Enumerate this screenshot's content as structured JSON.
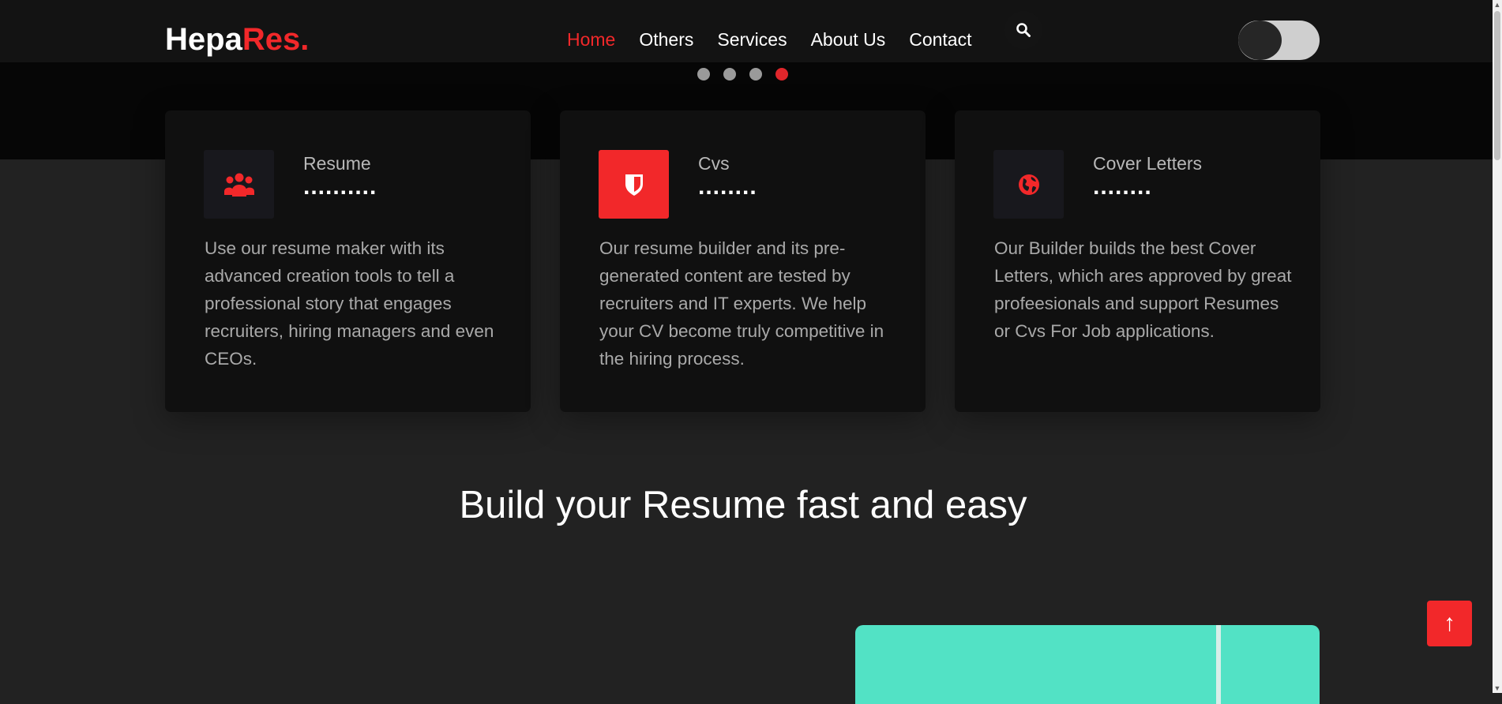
{
  "brand": {
    "part1": "Hepa",
    "part2": "Res."
  },
  "nav": {
    "items": [
      {
        "label": "Home",
        "active": true
      },
      {
        "label": "Others",
        "active": false
      },
      {
        "label": "Services",
        "active": false
      },
      {
        "label": "About Us",
        "active": false
      },
      {
        "label": "Contact",
        "active": false
      }
    ],
    "search_icon": "search-icon",
    "theme_toggle": "dark-mode-toggle"
  },
  "carousel": {
    "dot_count": 4,
    "active_index": 3
  },
  "cards": [
    {
      "icon": "users-icon",
      "title": "Resume",
      "dots": "..........",
      "description": "Use our resume maker with its advanced creation tools to tell a professional story that engages recruiters, hiring managers and even CEOs."
    },
    {
      "icon": "shield-icon",
      "title": "Cvs",
      "dots": "........",
      "description": "Our resume builder and its pre-generated content are tested by recruiters and IT experts. We help your CV become truly competitive in the hiring process."
    },
    {
      "icon": "globe-icon",
      "title": "Cover Letters",
      "dots": "........",
      "description": "Our Builder builds the best Cover Letters, which ares approved by great profeesionals and support Resumes or Cvs For Job applications."
    }
  ],
  "section": {
    "title": "Build your Resume fast and easy"
  },
  "back_to_top": {
    "label": "↑"
  },
  "colors": {
    "accent": "#f2282a",
    "teal": "#52e2c5",
    "background": "#222222"
  }
}
